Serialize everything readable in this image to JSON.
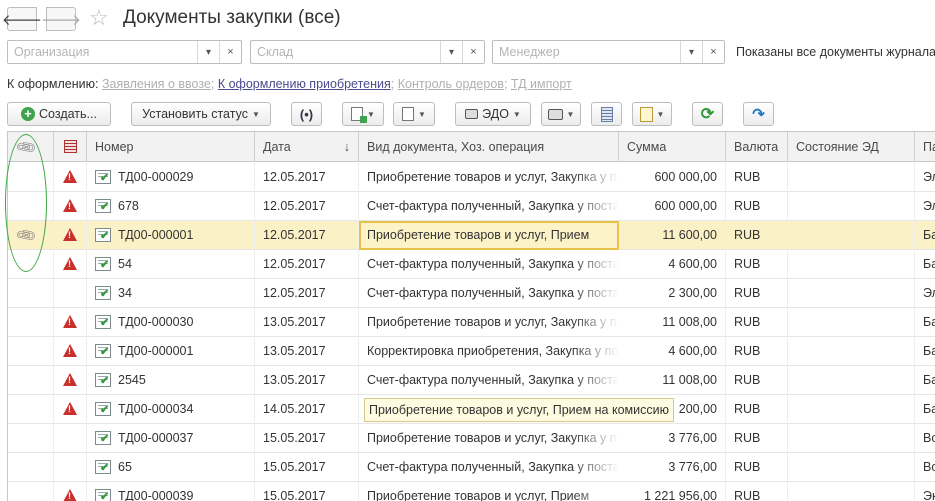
{
  "window": {
    "title": "Документы закупки (все)"
  },
  "filters": {
    "organization_placeholder": "Организация",
    "warehouse_placeholder": "Склад",
    "manager_placeholder": "Менеджер",
    "status_text": "Показаны все документы журнала"
  },
  "todo": {
    "label": "К оформлению:",
    "links": [
      {
        "label": "Заявления о ввозе",
        "active": false
      },
      {
        "label": "К оформлению приобретения",
        "active": true
      },
      {
        "label": "Контроль ордеров",
        "active": false
      },
      {
        "label": "ТД импорт",
        "active": false
      }
    ]
  },
  "toolbar": {
    "create_label": "Создать...",
    "set_status_label": "Установить статус",
    "edo_label": "ЭДО"
  },
  "table": {
    "columns": [
      "Номер",
      "Дата",
      "Вид документа, Хоз. операция",
      "Сумма",
      "Валюта",
      "Состояние ЭД",
      "Па"
    ],
    "sort_indicator": "↓",
    "rows": [
      {
        "attachment": false,
        "warning": true,
        "number": "ТД00-000029",
        "date": "12.05.2017",
        "doc_type": "Приобретение товаров и услуг, Закупка у поставщика",
        "sum": "600 000,00",
        "currency": "RUB",
        "ed_state": "",
        "last": "Эл",
        "selected": false
      },
      {
        "attachment": false,
        "warning": true,
        "number": "678",
        "date": "12.05.2017",
        "doc_type": "Счет-фактура полученный, Закупка у поставщика",
        "sum": "600 000,00",
        "currency": "RUB",
        "ed_state": "",
        "last": "Эл",
        "selected": false
      },
      {
        "attachment": true,
        "warning": true,
        "number": "ТД00-000001",
        "date": "12.05.2017",
        "doc_type": "Приобретение товаров и услуг, Прием",
        "sum": "11 600,00",
        "currency": "RUB",
        "ed_state": "",
        "last": "Ба",
        "selected": true
      },
      {
        "attachment": false,
        "warning": true,
        "number": "54",
        "date": "12.05.2017",
        "doc_type": "Счет-фактура полученный, Закупка у поставщика",
        "sum": "4 600,00",
        "currency": "RUB",
        "ed_state": "",
        "last": "Ба",
        "selected": false
      },
      {
        "attachment": false,
        "warning": false,
        "number": "34",
        "date": "12.05.2017",
        "doc_type": "Счет-фактура полученный, Закупка у поставщика",
        "sum": "2 300,00",
        "currency": "RUB",
        "ed_state": "",
        "last": "Эл",
        "selected": false
      },
      {
        "attachment": false,
        "warning": true,
        "number": "ТД00-000030",
        "date": "13.05.2017",
        "doc_type": "Приобретение товаров и услуг, Закупка у поставщика",
        "sum": "11 008,00",
        "currency": "RUB",
        "ed_state": "",
        "last": "Ба",
        "selected": false
      },
      {
        "attachment": false,
        "warning": true,
        "number": "ТД00-000001",
        "date": "13.05.2017",
        "doc_type": "Корректировка приобретения, Закупка у поставщика",
        "sum": "4 600,00",
        "currency": "RUB",
        "ed_state": "",
        "last": "Ба",
        "selected": false
      },
      {
        "attachment": false,
        "warning": true,
        "number": "2545",
        "date": "13.05.2017",
        "doc_type": "Счет-фактура полученный, Закупка у поставщика",
        "sum": "11 008,00",
        "currency": "RUB",
        "ed_state": "",
        "last": "Ба",
        "selected": false
      },
      {
        "attachment": false,
        "warning": true,
        "number": "ТД00-000034",
        "date": "14.05.2017",
        "doc_type": "Приобретение товаров и услуг, Прием на комиссию",
        "sum": "200,00",
        "currency": "RUB",
        "ed_state": "",
        "last": "Ба",
        "selected": false
      },
      {
        "attachment": false,
        "warning": false,
        "number": "ТД00-000037",
        "date": "15.05.2017",
        "doc_type": "Приобретение товаров и услуг, Закупка у поставщика",
        "sum": "3 776,00",
        "currency": "RUB",
        "ed_state": "",
        "last": "Во",
        "selected": false
      },
      {
        "attachment": false,
        "warning": false,
        "number": "65",
        "date": "15.05.2017",
        "doc_type": "Счет-фактура полученный, Закупка у поставщика",
        "sum": "3 776,00",
        "currency": "RUB",
        "ed_state": "",
        "last": "Во",
        "selected": false
      },
      {
        "attachment": false,
        "warning": true,
        "number": "ТД00-000039",
        "date": "15.05.2017",
        "doc_type": "Приобретение товаров и услуг, Прием",
        "sum": "1 221 956,00",
        "currency": "RUB",
        "ed_state": "",
        "last": "Эк",
        "selected": false
      }
    ]
  },
  "tooltip": {
    "text": "Приобретение товаров и услуг, Прием на комиссию"
  },
  "colors": {
    "selected_row": "#fbf1c6",
    "warning": "#c8302c",
    "accent_green": "#3fa34d",
    "annotation_circle": "#3aa640"
  }
}
